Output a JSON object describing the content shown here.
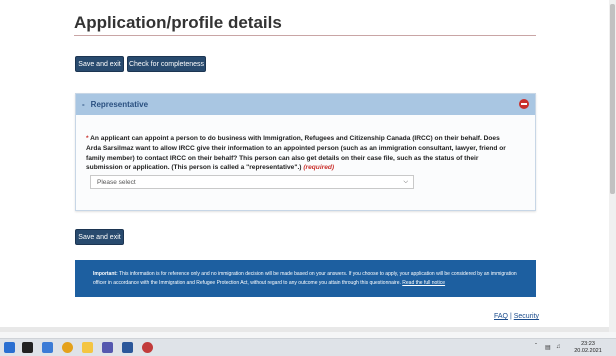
{
  "page": {
    "title": "Application/profile details"
  },
  "toolbar": {
    "save_exit": "Save and exit",
    "check_completeness": "Check for completeness"
  },
  "representative": {
    "header_dash": "-",
    "header_label": "Representative",
    "required_star": "*",
    "question": "An applicant can appoint a person to do business with Immigration, Refugees and Citizenship Canada (IRCC) on their behalf. Does Arda Sarsilmaz want to allow IRCC give their information to an appointed person (such as an immigration consultant, lawyer, friend or family member) to contact IRCC on their behalf? This person can also get details on their case file, such as the status of their submission or application. (This person is called a \"representative\".)",
    "required_label": "(required)",
    "select_value": "Please select"
  },
  "bottom": {
    "save_exit": "Save and exit"
  },
  "notice": {
    "important": "Important:",
    "text": "This information is for reference only and no immigration decision will be made based on your answers. If you choose to apply, your application will be considered by an immigration officer in accordance with the Immigration and Refugee Protection Act, without regard to any outcome you attain through this questionnaire.",
    "link": "Read the full notice"
  },
  "footer": {
    "faq": "FAQ",
    "separator": "|",
    "security": "Security"
  },
  "taskbar": {
    "time": "23:23",
    "date": "20.02.2021"
  },
  "colors": {
    "primary_button": "#284a6e",
    "panel_header": "#a9c6e2",
    "notice_bg": "#1d5fa0",
    "required": "#c9302c"
  }
}
